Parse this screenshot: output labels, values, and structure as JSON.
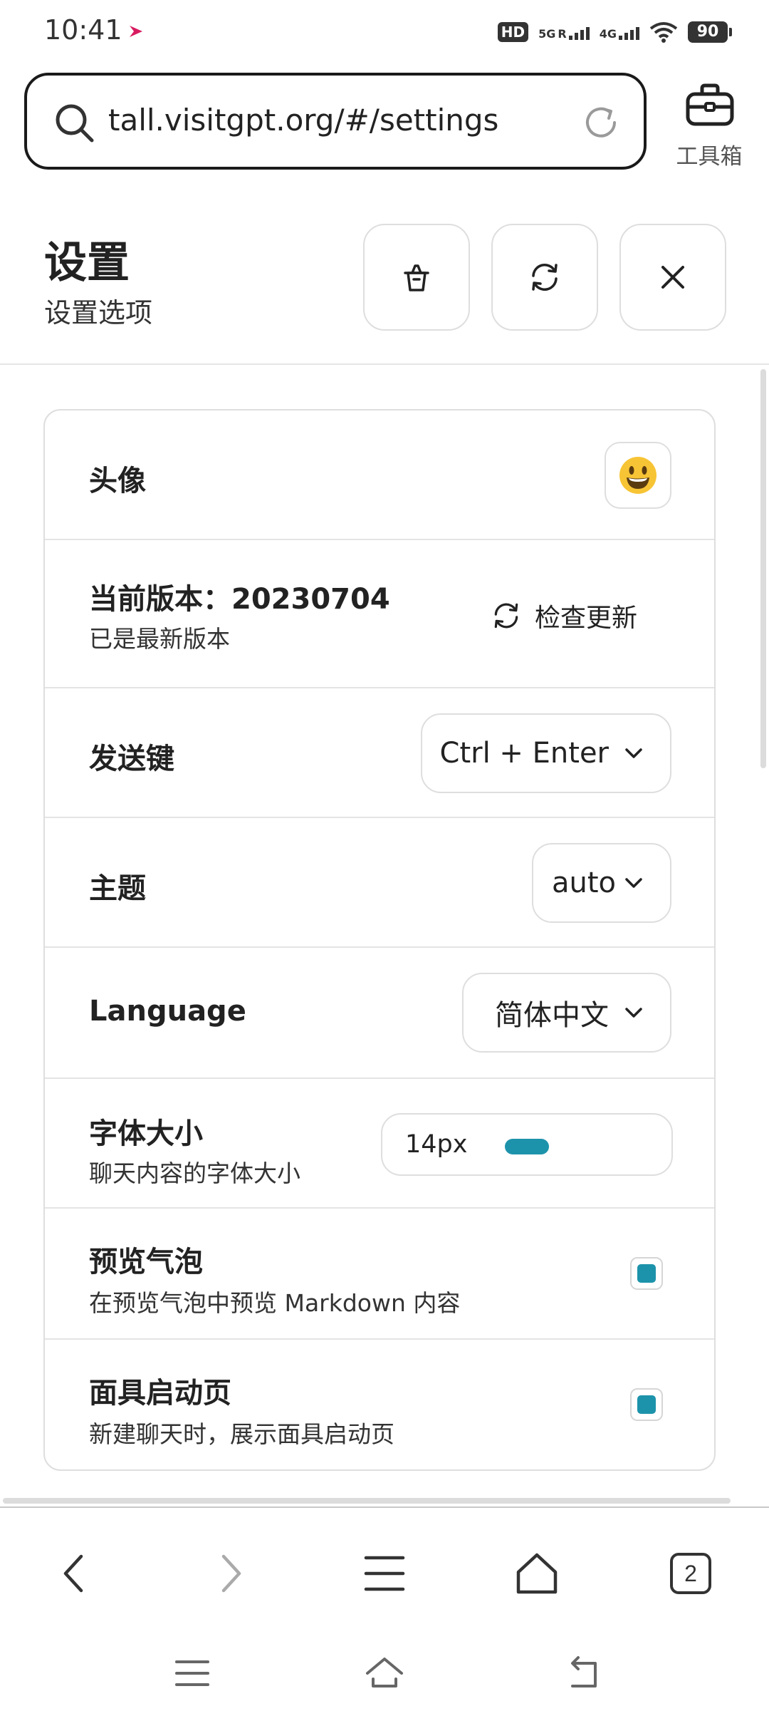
{
  "status_bar": {
    "time": "10:41",
    "hd_badge": "HD",
    "net_5g": "5G",
    "net_4g": "4G",
    "roaming": "R",
    "battery": "90"
  },
  "browser": {
    "url": "tall.visitgpt.org/#/settings",
    "toolbox_label": "工具箱"
  },
  "settings_header": {
    "title": "设置",
    "subtitle": "设置选项"
  },
  "settings": {
    "avatar": {
      "label": "头像"
    },
    "version": {
      "label": "当前版本：20230704",
      "status": "已是最新版本",
      "check_update_label": "检查更新"
    },
    "send_key": {
      "label": "发送键",
      "value": "Ctrl + Enter"
    },
    "theme": {
      "label": "主题",
      "value": "auto"
    },
    "language": {
      "label": "Language",
      "value": "简体中文"
    },
    "font_size": {
      "label": "字体大小",
      "description": "聊天内容的字体大小",
      "value": "14px"
    },
    "preview_bubble": {
      "label": "预览气泡",
      "description": "在预览气泡中预览 Markdown 内容",
      "checked": true
    },
    "mask_launcher": {
      "label": "面具启动页",
      "description": "新建聊天时，展示面具启动页",
      "checked": true
    }
  },
  "browser_nav": {
    "tab_count": "2"
  },
  "colors": {
    "accent": "#1d93ab",
    "border": "#dedede"
  }
}
